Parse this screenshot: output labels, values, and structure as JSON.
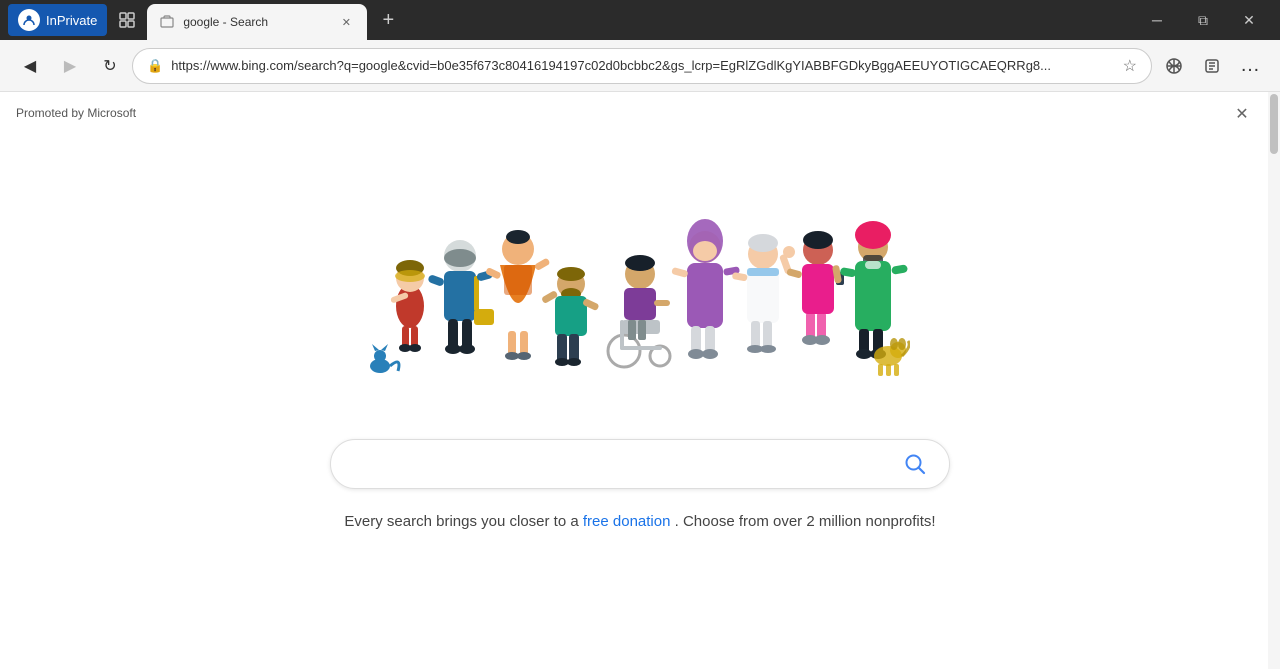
{
  "browser": {
    "inprivate_label": "InPrivate",
    "tab_title": "google - Search",
    "new_tab_label": "+",
    "address": "https://www.bing.com/search?q=google&cvid=b0e35f673c80416194197c02d0bcbbc2&gs_lcrp=EgRlZGdlKgYIABBFGDkyBggAEEUYOTIGCAEQRRg8...",
    "window_minimize": "─",
    "window_restore": "⧉",
    "window_close": "✕"
  },
  "page": {
    "promoted_label": "Promoted by Microsoft",
    "close_button_label": "✕",
    "search_placeholder": "",
    "tagline_pre": "Every search brings you closer to a",
    "tagline_link": "free donation",
    "tagline_post": ". Choose from over 2 million nonprofits!"
  }
}
